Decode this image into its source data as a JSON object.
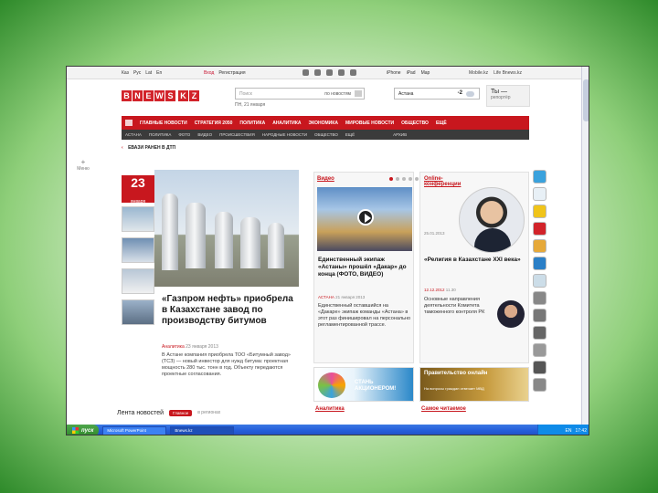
{
  "utilbar": {
    "languages": [
      "Каз",
      "Рус",
      "Lat",
      "En"
    ],
    "account": [
      "Вход",
      "Регистрация"
    ],
    "apps": [
      "iPhone",
      "iPad",
      "Map"
    ],
    "mobile": [
      "Mobile.kz",
      "Life Bnews.kz"
    ]
  },
  "logo": {
    "letters": [
      "B",
      "N",
      "E",
      "W",
      "S"
    ],
    "suffix": [
      "K",
      "Z"
    ]
  },
  "search": {
    "placeholder": "Поиск",
    "filter": "по новостям"
  },
  "date_line": "ПН, 21 января",
  "weather": {
    "city": "Астана",
    "temp": "-2"
  },
  "promo": {
    "line1": "Ты —",
    "line2": "репортёр"
  },
  "mainnav": [
    "ГЛАВНЫЕ НОВОСТИ",
    "СТРАТЕГИЯ 2050",
    "ПОЛИТИКА",
    "АНАЛИТИКА",
    "ЭКОНОМИКА",
    "МИРОВЫЕ НОВОСТИ",
    "ОБЩЕСТВО",
    "ЕЩЁ"
  ],
  "subnav": [
    "АСТАНА",
    "ПОЛИТИКА",
    "ФОТО",
    "ВИДЕО",
    "ПРОИСШЕСТВИЯ",
    "НАРОДНЫЕ НОВОСТИ",
    "ОБЩЕСТВО",
    "ЕЩЁ",
    "АРХИВ"
  ],
  "ticker": "ЕВАЗИ РАНЕН В ДТП",
  "menu_left": {
    "plus": "+",
    "label": "Меню"
  },
  "feature": {
    "day": "23",
    "month": "января",
    "headline": "«Газпром нефть» приобрела в Казахстане завод по производству битумов",
    "byline_tag": "Аналитика",
    "byline_date": "23 января 2013",
    "lead": "В Астане компания приобрела ТОО «Битумный завод» (ТСЗ) — новый инвестор для нужд битума: проектная мощность 280 тыс. тонн в год. Объекту передаются проектные согласования."
  },
  "news_strip": {
    "title": "Лента новостей",
    "tag": "Главное",
    "sub": "в регионах"
  },
  "video": {
    "title": "Видео",
    "more": "Online-конференции",
    "card_title": "Единственный экипаж «Астаны» прошёл «Дакар» до конца (ФОТО, ВИДЕО)",
    "meta_tag": "АСТАНА",
    "meta_date": "21 января 2013",
    "text": "Единственный оставшийся на «Дакаре» экипаж команды «Астана» в этот раз финишировал на персонально регламентированной трассе."
  },
  "conference": {
    "date": "25.01.2013",
    "card_title": "«Религия в Казахстане XXI века»",
    "date2": "12.12.2012",
    "time2": "11.30",
    "text": "Основные направления деятельности Комитета таможенного контроля РК"
  },
  "banners": {
    "expo_text": "СТАНЬ АКЦИОНЕРОМ!",
    "gov_title": "Правительство онлайн",
    "gov_small": "На вопросы граждан отвечает МВД"
  },
  "bottom_links": [
    "Аналитика",
    "Самое читаемое"
  ],
  "taskbar": {
    "start": "пуск",
    "tasks": [
      "Microsoft PowerPoint",
      "Bnews.kz"
    ],
    "tray": [
      "EN",
      "17:42"
    ]
  }
}
